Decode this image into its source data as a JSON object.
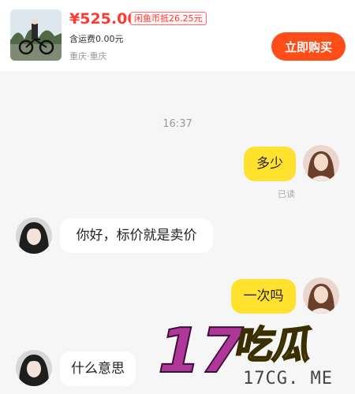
{
  "product": {
    "price": "¥525.00",
    "coin_deduct": "闲鱼币抵26.25元",
    "shipping": "含运费0.00元",
    "location": "重庆·重庆",
    "buy_label": "立即购买"
  },
  "chat": {
    "timestamp": "16:37",
    "messages": [
      {
        "from": "me",
        "text": "多少",
        "status": "已读"
      },
      {
        "from": "them",
        "text": "你好，标价就是卖价"
      },
      {
        "from": "me",
        "text": "一次吗"
      },
      {
        "from": "them",
        "text": "什么意思"
      }
    ]
  },
  "watermark": {
    "brand": "17吃瓜",
    "url": "17CG. ME"
  },
  "colors": {
    "price_red": "#ff3b30",
    "buy_button": "#ff4d1a",
    "my_bubble": "#ffe12e",
    "watermark_purple": "#b0379a",
    "watermark_yellow": "#f7e21a"
  }
}
